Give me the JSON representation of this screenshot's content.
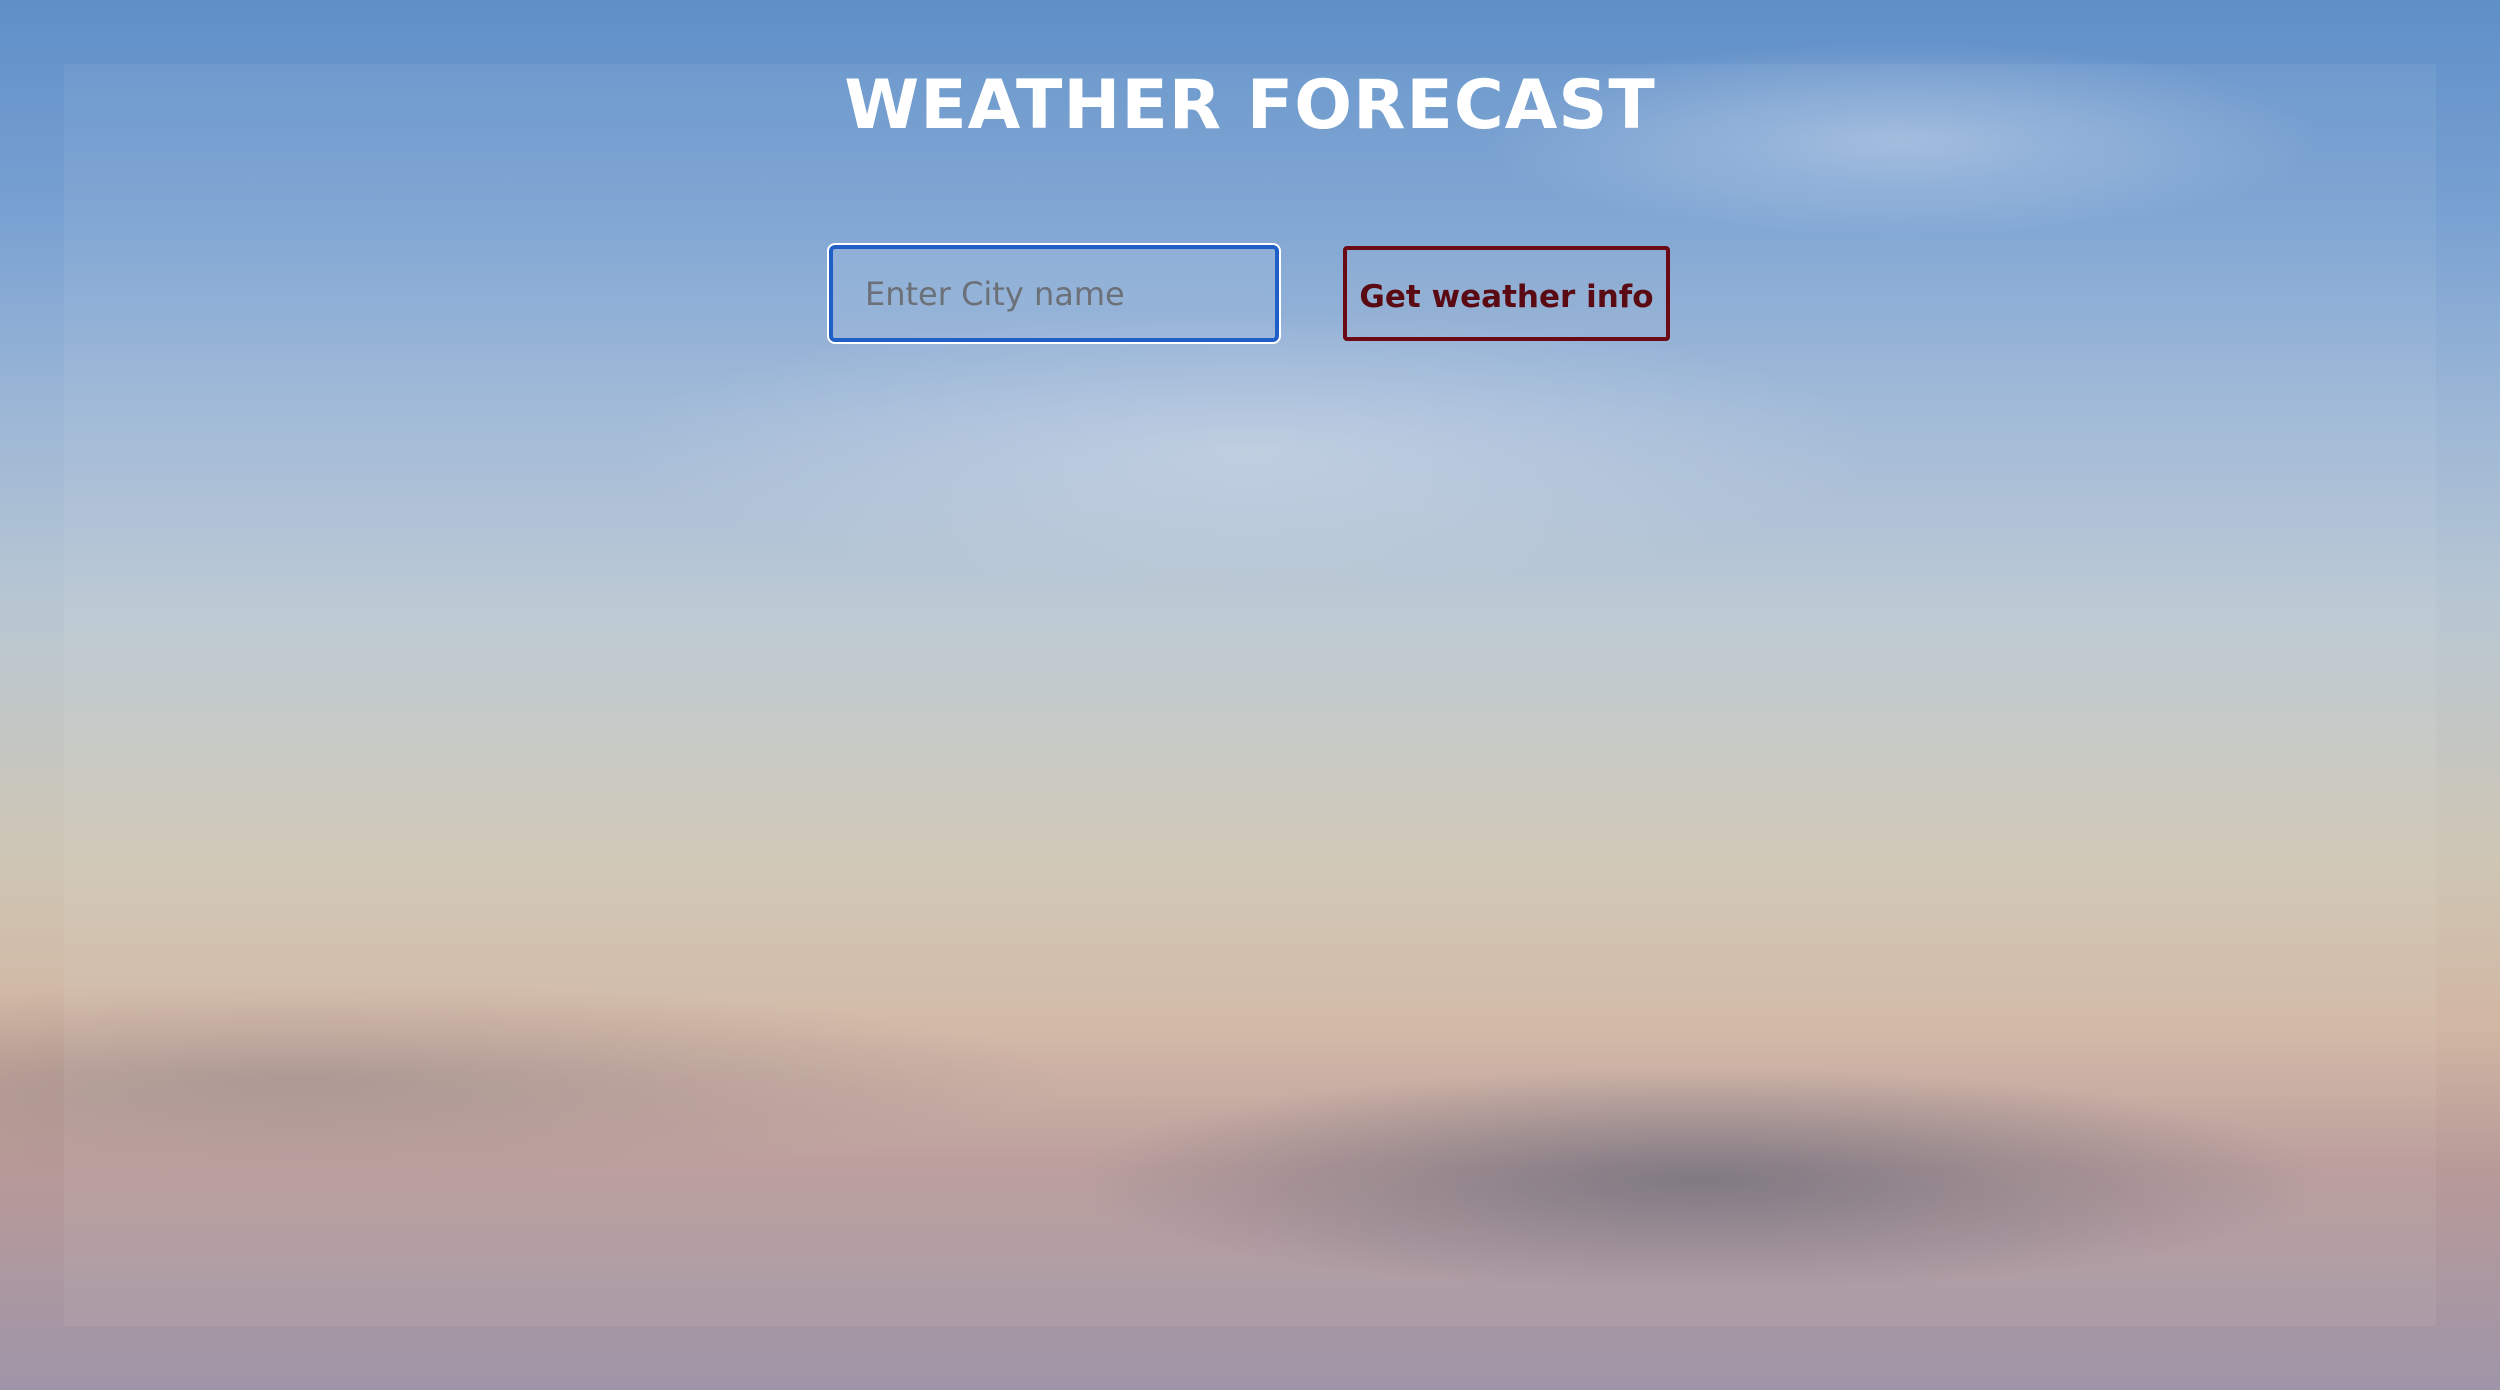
{
  "header": {
    "title": "WEATHER FORECAST"
  },
  "search": {
    "placeholder": "Enter City name",
    "value": "",
    "button_label": "Get weather info"
  },
  "colors": {
    "input_border": "#1f5fc7",
    "button_border": "#6b0a14",
    "button_text": "#5a0a12",
    "title_text": "#ffffff"
  }
}
